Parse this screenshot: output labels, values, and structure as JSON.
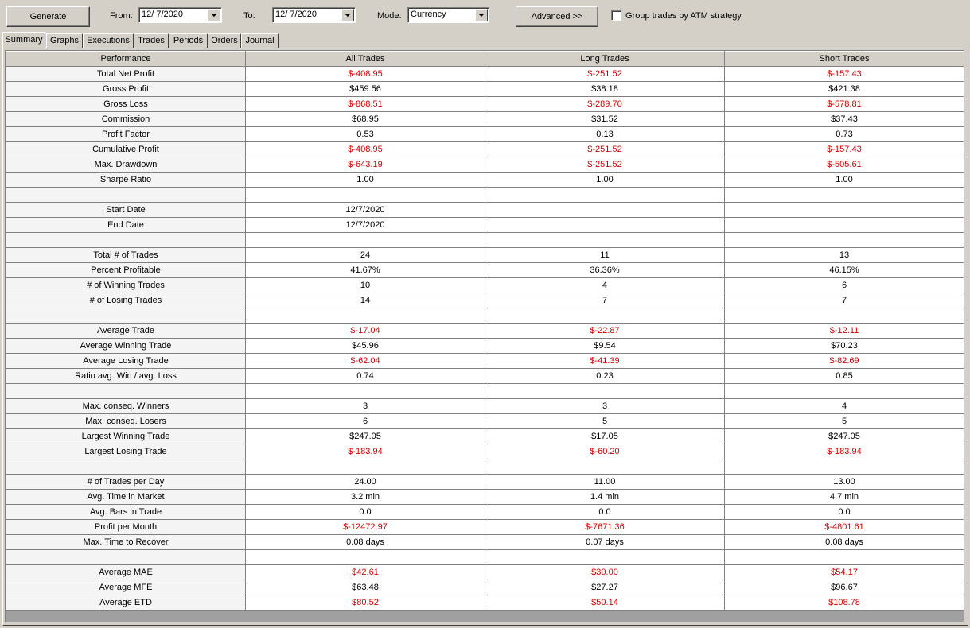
{
  "toolbar": {
    "generate_label": "Generate",
    "from_label": "From:",
    "from_value": "12/ 7/2020",
    "to_label": "To:",
    "to_value": "12/ 7/2020",
    "mode_label": "Mode:",
    "mode_value": "Currency",
    "advanced_label": "Advanced >>",
    "group_label": "Group trades by ATM strategy",
    "group_checked": false
  },
  "tabs": [
    {
      "label": "Summary",
      "active": true
    },
    {
      "label": "Graphs",
      "active": false
    },
    {
      "label": "Executions",
      "active": false
    },
    {
      "label": "Trades",
      "active": false
    },
    {
      "label": "Periods",
      "active": false
    },
    {
      "label": "Orders",
      "active": false
    },
    {
      "label": "Journal",
      "active": false
    }
  ],
  "report": {
    "columns": [
      "Performance",
      "All Trades",
      "Long Trades",
      "Short Trades"
    ],
    "rows": [
      {
        "label": "Total Net Profit",
        "values": [
          "$-408.95",
          "$-251.52",
          "$-157.43"
        ],
        "negative": [
          true,
          true,
          true
        ]
      },
      {
        "label": "Gross Profit",
        "values": [
          "$459.56",
          "$38.18",
          "$421.38"
        ],
        "negative": [
          false,
          false,
          false
        ]
      },
      {
        "label": "Gross Loss",
        "values": [
          "$-868.51",
          "$-289.70",
          "$-578.81"
        ],
        "negative": [
          true,
          true,
          true
        ]
      },
      {
        "label": "Commission",
        "values": [
          "$68.95",
          "$31.52",
          "$37.43"
        ],
        "negative": [
          false,
          false,
          false
        ]
      },
      {
        "label": "Profit Factor",
        "values": [
          "0.53",
          "0.13",
          "0.73"
        ],
        "negative": [
          false,
          false,
          false
        ]
      },
      {
        "label": "Cumulative Profit",
        "values": [
          "$-408.95",
          "$-251.52",
          "$-157.43"
        ],
        "negative": [
          true,
          true,
          true
        ]
      },
      {
        "label": "Max. Drawdown",
        "values": [
          "$-643.19",
          "$-251.52",
          "$-505.61"
        ],
        "negative": [
          true,
          true,
          true
        ]
      },
      {
        "label": "Sharpe Ratio",
        "values": [
          "1.00",
          "1.00",
          "1.00"
        ],
        "negative": [
          false,
          false,
          false
        ]
      },
      {
        "label": "",
        "values": [
          "",
          "",
          ""
        ],
        "negative": [
          false,
          false,
          false
        ]
      },
      {
        "label": "Start Date",
        "values": [
          "12/7/2020",
          "",
          ""
        ],
        "negative": [
          false,
          false,
          false
        ]
      },
      {
        "label": "End Date",
        "values": [
          "12/7/2020",
          "",
          ""
        ],
        "negative": [
          false,
          false,
          false
        ]
      },
      {
        "label": "",
        "values": [
          "",
          "",
          ""
        ],
        "negative": [
          false,
          false,
          false
        ]
      },
      {
        "label": "Total # of Trades",
        "values": [
          "24",
          "11",
          "13"
        ],
        "negative": [
          false,
          false,
          false
        ]
      },
      {
        "label": "Percent Profitable",
        "values": [
          "41.67%",
          "36.36%",
          "46.15%"
        ],
        "negative": [
          false,
          false,
          false
        ]
      },
      {
        "label": "# of Winning Trades",
        "values": [
          "10",
          "4",
          "6"
        ],
        "negative": [
          false,
          false,
          false
        ]
      },
      {
        "label": "# of Losing Trades",
        "values": [
          "14",
          "7",
          "7"
        ],
        "negative": [
          false,
          false,
          false
        ]
      },
      {
        "label": "",
        "values": [
          "",
          "",
          ""
        ],
        "negative": [
          false,
          false,
          false
        ]
      },
      {
        "label": "Average Trade",
        "values": [
          "$-17.04",
          "$-22.87",
          "$-12.11"
        ],
        "negative": [
          true,
          true,
          true
        ]
      },
      {
        "label": "Average Winning Trade",
        "values": [
          "$45.96",
          "$9.54",
          "$70.23"
        ],
        "negative": [
          false,
          false,
          false
        ]
      },
      {
        "label": "Average Losing Trade",
        "values": [
          "$-62.04",
          "$-41.39",
          "$-82.69"
        ],
        "negative": [
          true,
          true,
          true
        ]
      },
      {
        "label": "Ratio avg. Win / avg. Loss",
        "values": [
          "0.74",
          "0.23",
          "0.85"
        ],
        "negative": [
          false,
          false,
          false
        ]
      },
      {
        "label": "",
        "values": [
          "",
          "",
          ""
        ],
        "negative": [
          false,
          false,
          false
        ]
      },
      {
        "label": "Max. conseq. Winners",
        "values": [
          "3",
          "3",
          "4"
        ],
        "negative": [
          false,
          false,
          false
        ]
      },
      {
        "label": "Max. conseq. Losers",
        "values": [
          "6",
          "5",
          "5"
        ],
        "negative": [
          false,
          false,
          false
        ]
      },
      {
        "label": "Largest Winning Trade",
        "values": [
          "$247.05",
          "$17.05",
          "$247.05"
        ],
        "negative": [
          false,
          false,
          false
        ]
      },
      {
        "label": "Largest Losing Trade",
        "values": [
          "$-183.94",
          "$-60.20",
          "$-183.94"
        ],
        "negative": [
          true,
          true,
          true
        ]
      },
      {
        "label": "",
        "values": [
          "",
          "",
          ""
        ],
        "negative": [
          false,
          false,
          false
        ]
      },
      {
        "label": "# of Trades per Day",
        "values": [
          "24.00",
          "11.00",
          "13.00"
        ],
        "negative": [
          false,
          false,
          false
        ]
      },
      {
        "label": "Avg. Time in Market",
        "values": [
          "3.2 min",
          "1.4 min",
          "4.7 min"
        ],
        "negative": [
          false,
          false,
          false
        ]
      },
      {
        "label": "Avg. Bars in Trade",
        "values": [
          "0.0",
          "0.0",
          "0.0"
        ],
        "negative": [
          false,
          false,
          false
        ]
      },
      {
        "label": "Profit per Month",
        "values": [
          "$-12472.97",
          "$-7671.36",
          "$-4801.61"
        ],
        "negative": [
          true,
          true,
          true
        ]
      },
      {
        "label": "Max. Time to Recover",
        "values": [
          "0.08 days",
          "0.07 days",
          "0.08 days"
        ],
        "negative": [
          false,
          false,
          false
        ]
      },
      {
        "label": "",
        "values": [
          "",
          "",
          ""
        ],
        "negative": [
          false,
          false,
          false
        ]
      },
      {
        "label": "Average MAE",
        "values": [
          "$42.61",
          "$30.00",
          "$54.17"
        ],
        "negative": [
          true,
          true,
          true
        ]
      },
      {
        "label": "Average MFE",
        "values": [
          "$63.48",
          "$27.27",
          "$96.67"
        ],
        "negative": [
          false,
          false,
          false
        ]
      },
      {
        "label": "Average ETD",
        "values": [
          "$80.52",
          "$50.14",
          "$108.78"
        ],
        "negative": [
          true,
          true,
          true
        ]
      }
    ]
  }
}
